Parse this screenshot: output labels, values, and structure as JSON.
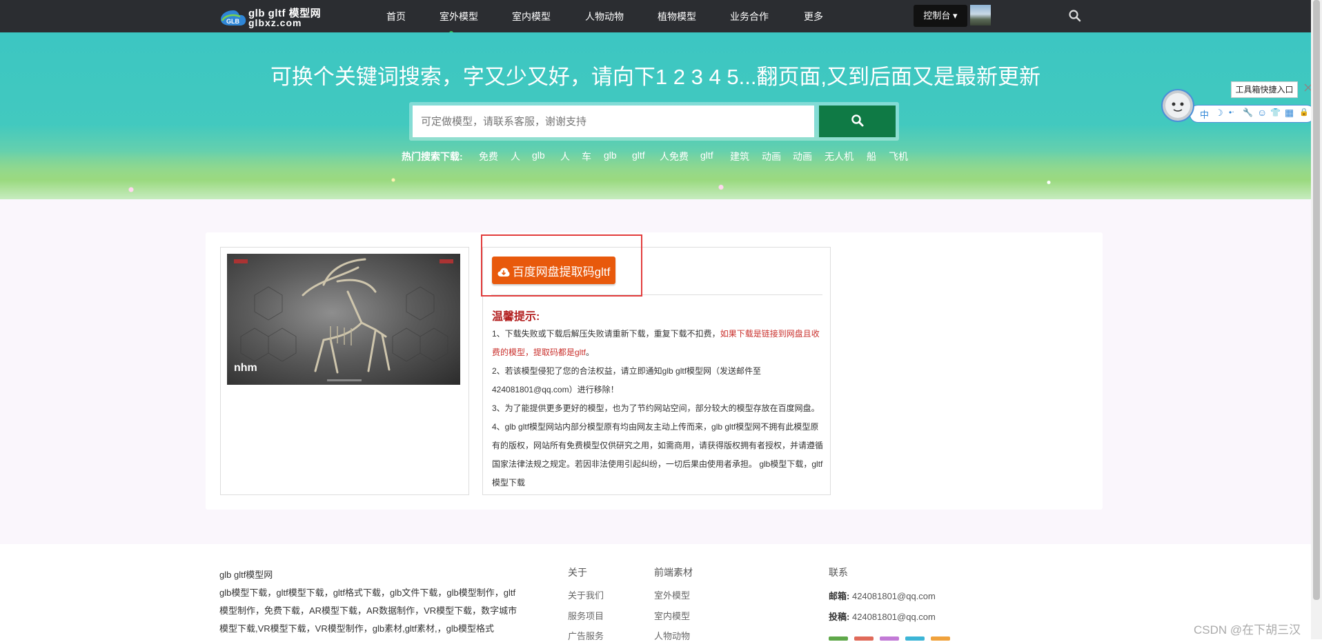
{
  "logo": {
    "line1": "glb gltf 模型网",
    "line2": "glbxz.com",
    "badge": "GLB"
  },
  "nav": {
    "items": [
      "首页",
      "室外模型",
      "室内模型",
      "人物动物",
      "植物模型",
      "业务合作",
      "更多"
    ],
    "console": "控制台 ▾"
  },
  "hero": {
    "title": "可换个关键词搜索，字又少又好，请向下1 2 3 4 5...翻页面,又到后面又是最新更新",
    "search_placeholder": "可定做模型，请联系客服，谢谢支持",
    "hot_label": "热门搜索下载:",
    "hot_tags": [
      "免费",
      "人",
      "glb",
      "人",
      "车",
      "glb",
      "gltf",
      "人免费",
      "gltf",
      "建筑",
      "动画",
      "动画",
      "无人机",
      "船",
      "飞机"
    ]
  },
  "detail": {
    "thumb_logo": "nhm",
    "download_label": "百度网盘提取码gltf",
    "tip_title": "温馨提示:",
    "tip1_a": "1、下载失败或下载后解压失败请重新下载，重复下载不扣费，",
    "tip1_b": "如果下载是链接到网盘且收费的模型，提取码都是gltf",
    "tip1_c": "。",
    "tip2": "2、若该模型侵犯了您的合法权益，请立即通知glb gltf模型网（发送邮件至424081801@qq.com）进行移除！",
    "tip3": "3、为了能提供更多更好的模型，也为了节约网站空间，部分较大的模型存放在百度网盘。",
    "tip4": "4、glb gltf模型网站内部分模型原有均由网友主动上传而来，glb gltf模型网不拥有此模型原有的版权，网站所有免费模型仅供研究之用，如需商用，请获得版权拥有者授权，并请遵循国家法律法规之规定。若因非法使用引起纠纷，一切后果由使用者承担。 glb模型下载，gltf模型下载"
  },
  "footer": {
    "site_name": "glb gltf模型网",
    "description": "glb模型下载，gltf模型下载，gltf格式下载，glb文件下载，glb模型制作，gltf模型制作，免费下载，AR模型下载，AR数据制作，VR模型下载，数字城市模型下载,VR模型下载，VR模型制作，glb素材,gltf素材,，glb模型格式",
    "about_title": "关于",
    "about_links": [
      "关于我们",
      "服务项目",
      "广告服务"
    ],
    "assets_title": "前端素材",
    "assets_links": [
      "室外模型",
      "室内模型",
      "人物动物"
    ],
    "contact_title": "联系",
    "email_label": "邮箱:",
    "email": "424081801@qq.com",
    "submit_label": "投稿:",
    "submit_email": "424081801@qq.com"
  },
  "widget": {
    "tooltip": "工具箱快捷入口",
    "icons": [
      "中",
      "☽",
      "•ᐧ",
      "🔧",
      "☺",
      "👕",
      "▦",
      "🔒"
    ]
  },
  "watermark": "CSDN @在下胡三汉"
}
